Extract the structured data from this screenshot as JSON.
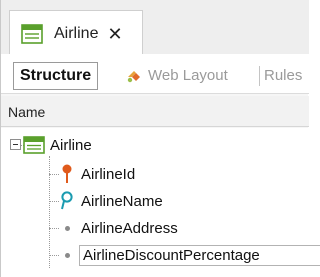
{
  "document_tab": {
    "label": "Airline",
    "close_glyph": "✕",
    "icon": "transaction-table-icon"
  },
  "toolbar": {
    "structure_label": "Structure",
    "web_layout_label": "Web Layout",
    "rules_label": "Rules"
  },
  "column_header": {
    "name": "Name"
  },
  "tree": {
    "root": {
      "label": "Airline",
      "icon": "transaction-table-icon",
      "expanded": true
    },
    "attributes": [
      {
        "label": "AirlineId",
        "icon": "primary-key-icon",
        "color": "#e05a1c"
      },
      {
        "label": "AirlineName",
        "icon": "description-attribute-icon",
        "color": "#1a9bb0"
      },
      {
        "label": "AirlineAddress",
        "icon": "attribute-dot-icon",
        "color": "#8a8a8a"
      },
      {
        "label": "AirlineDiscountPercentage",
        "icon": "attribute-dot-icon",
        "color": "#8a8a8a",
        "selected": true
      }
    ]
  },
  "colors": {
    "accent_green": "#5aa02c",
    "key_orange": "#e05a1c",
    "description_teal": "#1a9bb0"
  }
}
